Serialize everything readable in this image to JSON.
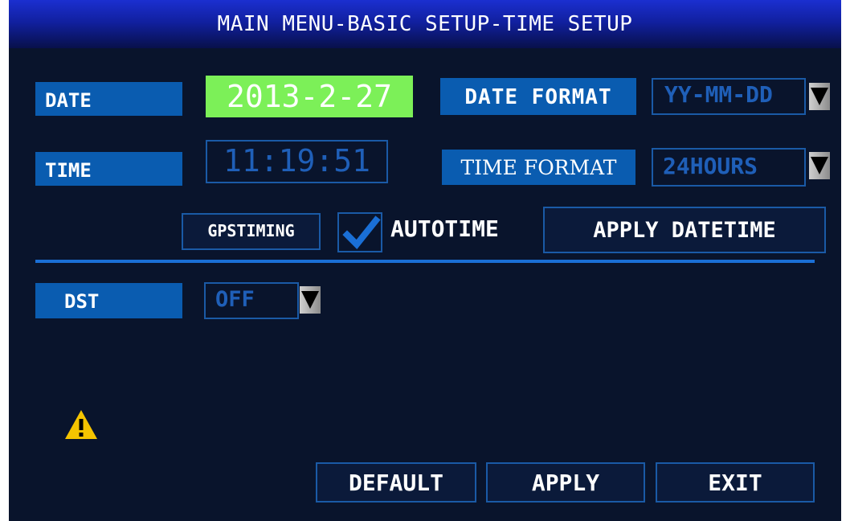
{
  "title": "MAIN MENU-BASIC SETUP-TIME SETUP",
  "date": {
    "label": "DATE",
    "value": "2013-2-27"
  },
  "date_format": {
    "label": "DATE FORMAT",
    "value": "YY-MM-DD"
  },
  "time": {
    "label": "TIME",
    "value": "11:19:51"
  },
  "time_format": {
    "label": "TIME FORMAT",
    "value": "24HOURS"
  },
  "gps_timing": {
    "label": "GPSTIMING"
  },
  "autotime": {
    "label": "AUTOTIME",
    "checked": true
  },
  "apply_datetime": {
    "label": "APPLY DATETIME"
  },
  "dst": {
    "label": "DST",
    "value": "OFF"
  },
  "warning": {
    "icon": "warning-icon"
  },
  "buttons": {
    "default": "DEFAULT",
    "apply": "APPLY",
    "exit": "EXIT"
  },
  "colors": {
    "background": "#09142c",
    "label_bg": "#0a5cb0",
    "date_highlight": "#7cf058",
    "field_text": "#1f5fb8",
    "border": "#1a5aa6",
    "warning": "#f5c400"
  }
}
